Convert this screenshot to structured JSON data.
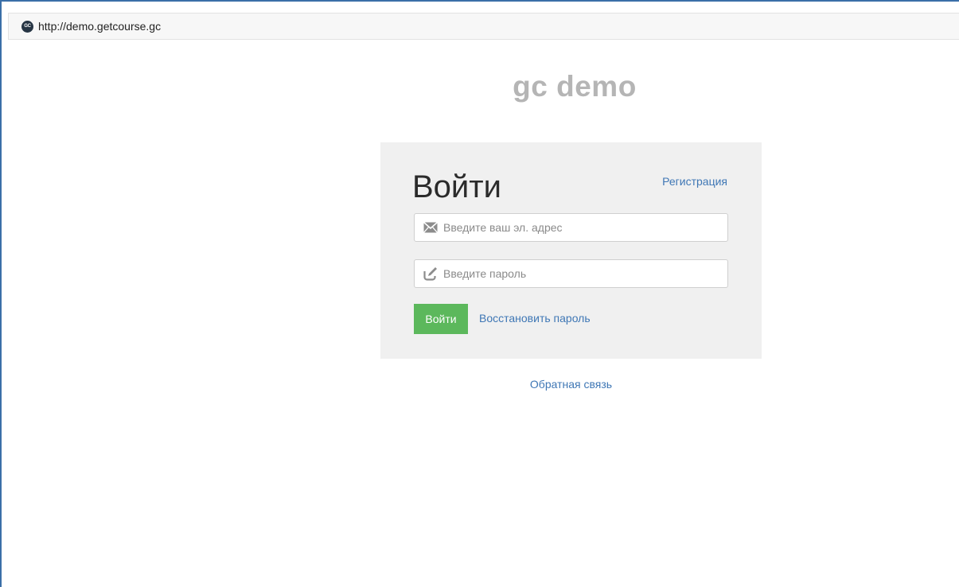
{
  "browser": {
    "url": "http://demo.getcourse.gc",
    "favicon_text": "GC"
  },
  "page": {
    "brand": "gc demo"
  },
  "login_form": {
    "title": "Войти",
    "register_link": "Регистрация",
    "email_placeholder": "Введите ваш эл. адрес",
    "email_icon": "envelope-icon",
    "password_placeholder": "Введите пароль",
    "password_icon": "edit-icon",
    "submit_label": "Войти",
    "restore_link": "Восстановить пароль",
    "accent_color": "#5cb85c",
    "link_color": "#3f77b5"
  },
  "footer": {
    "feedback_link": "Обратная связь"
  }
}
